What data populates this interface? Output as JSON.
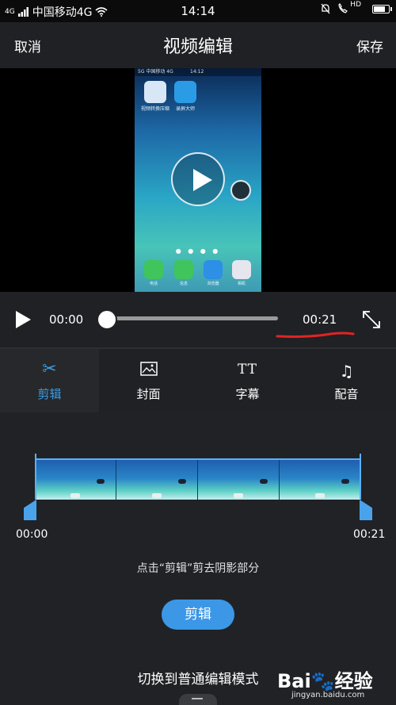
{
  "status_bar": {
    "signal_label": "4G",
    "carrier": "中国移动4G",
    "time": "14:14",
    "hd_label": "HD"
  },
  "header": {
    "cancel": "取消",
    "title": "视频编辑",
    "save": "保存"
  },
  "preview": {
    "inner_status": "5G 中国移动 4G",
    "inner_time": "14:12",
    "apps_top": [
      {
        "label": "视频转换压缩",
        "color": "#d7e7f6"
      },
      {
        "label": "录屏大师",
        "color": "#2c9be6"
      }
    ],
    "dock": [
      {
        "label": "电话",
        "color": "#3fc55b"
      },
      {
        "label": "信息",
        "color": "#3fc55b"
      },
      {
        "label": "浏览器",
        "color": "#2d8fe6"
      },
      {
        "label": "相机",
        "color": "#e6e6ee"
      }
    ]
  },
  "player": {
    "current_time": "00:00",
    "total_time": "00:21",
    "progress": 0
  },
  "tabs": [
    {
      "name": "cut",
      "icon": "scissors-icon",
      "label": "剪辑",
      "active": true
    },
    {
      "name": "cover",
      "icon": "image-icon",
      "label": "封面",
      "active": false
    },
    {
      "name": "subtitle",
      "icon": "text-icon",
      "label": "字幕",
      "active": false
    },
    {
      "name": "music",
      "icon": "music-icon",
      "label": "配音",
      "active": false
    }
  ],
  "tab_glyphs": {
    "cut": "✂",
    "subtitle": "TT",
    "music": "♫"
  },
  "trim": {
    "start": "00:00",
    "end": "00:21",
    "hint": "点击“剪辑”剪去阴影部分",
    "cut_button": "剪辑",
    "switch_mode": "切换到普通编辑模式"
  },
  "watermark": {
    "logo_left": "Bai",
    "logo_right": "经验",
    "site": "jingyan.baidu.com"
  },
  "colors": {
    "accent": "#3c97e6",
    "background": "#1f2124",
    "annotation_red": "#e02424"
  }
}
